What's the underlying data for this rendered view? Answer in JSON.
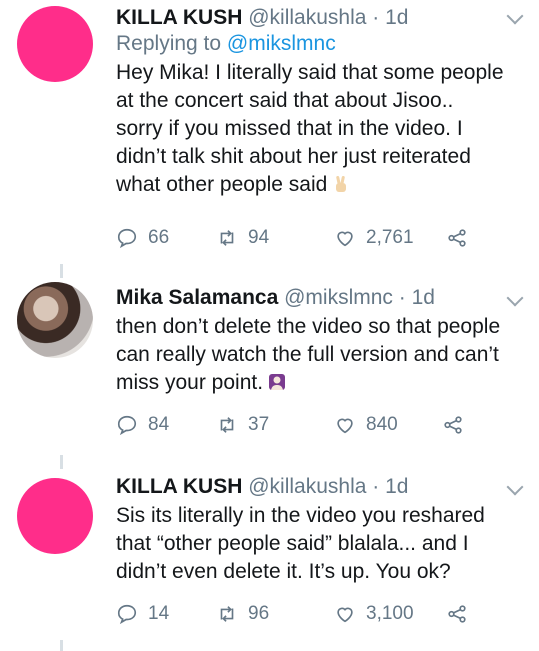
{
  "tweets": [
    {
      "name": "KILLA KUSH",
      "handle": "@killakushla",
      "time": "· 1d",
      "reply_prefix": "Replying to",
      "reply_handle": "@mikslmnc",
      "lines": [
        "Hey Mika! I literally said that some people",
        "at the concert said that about Jisoo..",
        "sorry if you missed that in the video. I",
        "didn’t talk shit about her just reiterated",
        "what other people said"
      ],
      "emoji": "victory-hand",
      "replies": "66",
      "retweets": "94",
      "likes": "2,761"
    },
    {
      "name": "Mika Salamanca",
      "handle": "@mikslmnc",
      "time": "· 1d",
      "lines": [
        "then don’t delete the video so that people",
        "can really watch the full version and can’t",
        "miss your point."
      ],
      "emoji": "person-gesturing",
      "replies": "84",
      "retweets": "37",
      "likes": "840"
    },
    {
      "name": "KILLA KUSH",
      "handle": "@killakushla",
      "time": "· 1d",
      "lines": [
        "Sis its literally in the video you reshared",
        "that “other people said” blalala... and I",
        "didn’t even delete it. It’s up. You ok?"
      ],
      "replies": "14",
      "retweets": "96",
      "likes": "3,100"
    }
  ],
  "colors": {
    "avatar_pink": "#ff2d8a",
    "link_blue": "#1b95e0",
    "muted_gray": "#657786",
    "text": "#14171a"
  }
}
